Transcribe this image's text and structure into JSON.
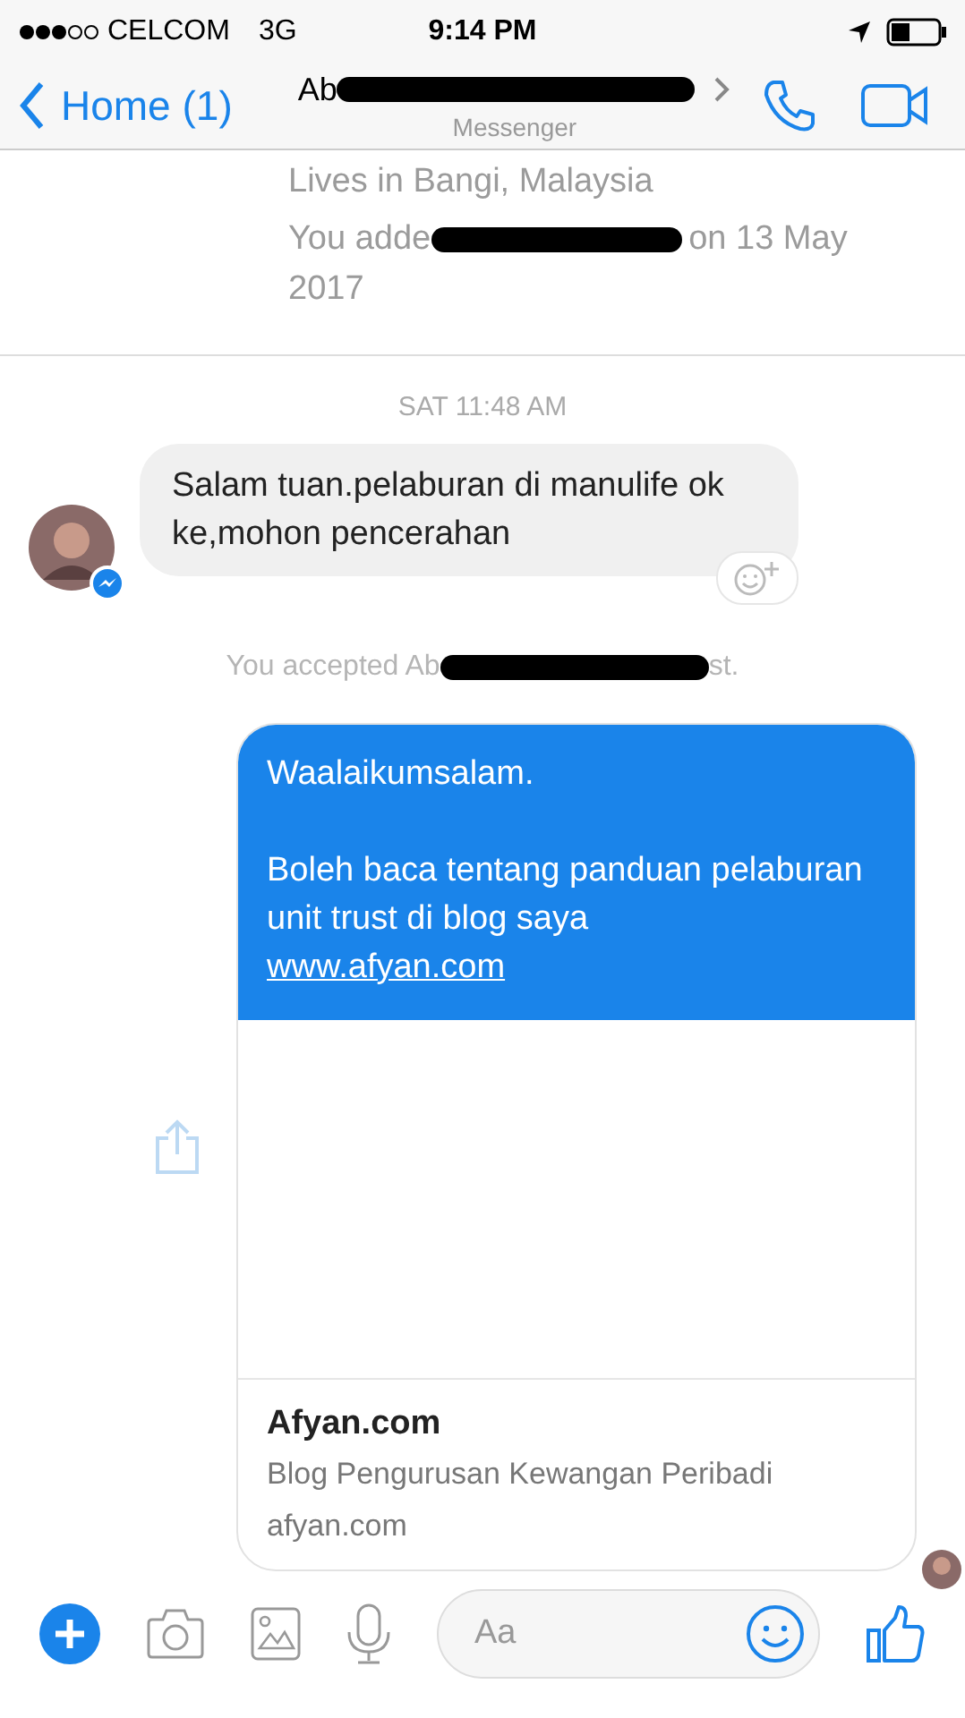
{
  "status_bar": {
    "carrier": "CELCOM",
    "network": "3G",
    "time": "9:14 PM"
  },
  "header": {
    "back_label": "Home (1)",
    "title": "Ab",
    "subtitle": "Messenger"
  },
  "profile": {
    "location": "Lives in Bangi, Malaysia",
    "added_prefix": "You adde",
    "added_suffix": "on 13 May",
    "added_suffix_wrap": "2017"
  },
  "messages": [
    {
      "kind": "timestamp",
      "text": "SAT 11:48 AM"
    },
    {
      "kind": "incoming",
      "text": "Salam tuan.pelaburan di manulife ok ke,mohon pencerahan"
    },
    {
      "kind": "notice",
      "prefix": "You accepted Ab",
      "suffix": "st."
    },
    {
      "kind": "outgoing_link",
      "greeting": "Waalaikumsalam.",
      "body": "Boleh baca tentang panduan pelaburan unit trust di blog saya",
      "link": "www.afyan.com",
      "preview": {
        "title": "Afyan.com",
        "description": "Blog Pengurusan Kewangan Peribadi",
        "domain": "afyan.com"
      }
    }
  ],
  "composer": {
    "placeholder": "Aa"
  }
}
